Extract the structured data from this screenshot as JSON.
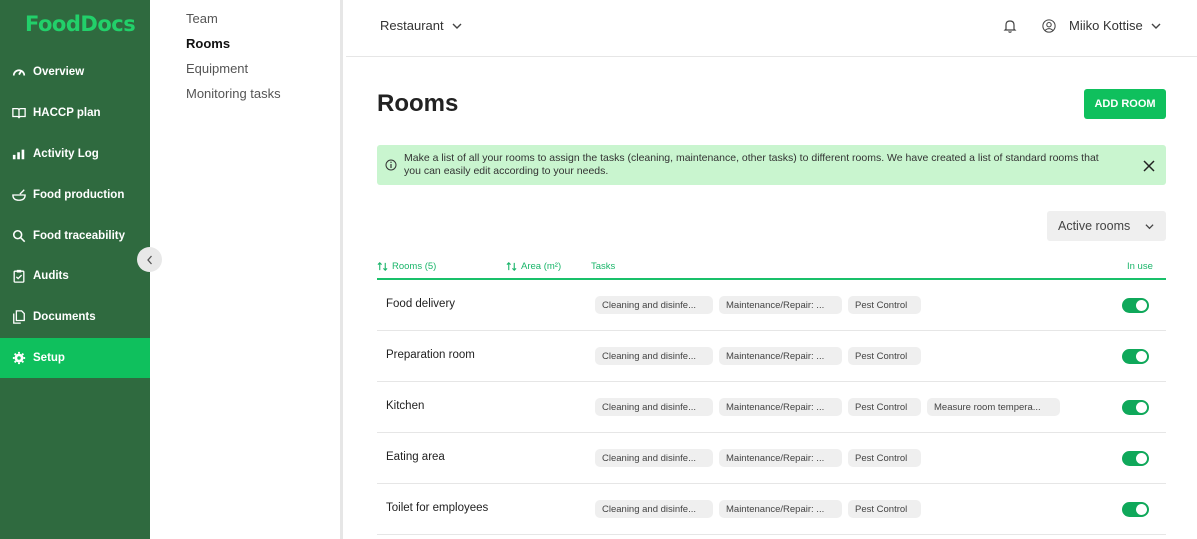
{
  "brand": {
    "logo_text": "FoodDocs",
    "logo_color": "#22d06a",
    "sidebar_bg": "#2f6a3f",
    "accent": "#0fc05d"
  },
  "sidebar": {
    "items": [
      {
        "label": "Overview",
        "icon": "gauge-icon"
      },
      {
        "label": "HACCP plan",
        "icon": "book-icon"
      },
      {
        "label": "Activity Log",
        "icon": "bar-chart-icon"
      },
      {
        "label": "Food production",
        "icon": "bowl-icon"
      },
      {
        "label": "Food traceability",
        "icon": "search-icon"
      },
      {
        "label": "Audits",
        "icon": "clipboard-icon"
      },
      {
        "label": "Documents",
        "icon": "documents-icon"
      },
      {
        "label": "Setup",
        "icon": "gear-icon",
        "active": true
      }
    ]
  },
  "subnav": {
    "items": [
      {
        "label": "Team"
      },
      {
        "label": "Rooms",
        "active": true
      },
      {
        "label": "Equipment"
      },
      {
        "label": "Monitoring tasks"
      }
    ]
  },
  "header": {
    "location": "Restaurant",
    "user_name": "Miiko Kottise"
  },
  "main": {
    "title": "Rooms",
    "add_button": "ADD ROOM",
    "info_text": "Make a list of all your rooms to assign the tasks (cleaning, maintenance, other tasks) to different rooms. We have created a list of standard rooms that you can easily edit according to your needs.",
    "filter_label": "Active rooms",
    "table": {
      "columns": {
        "rooms": "Rooms (5)",
        "area": "Area (m²)",
        "tasks": "Tasks",
        "in_use": "In use"
      },
      "rows": [
        {
          "name": "Food delivery",
          "tasks": [
            "Cleaning and disinfe...",
            "Maintenance/Repair: ...",
            "Pest Control"
          ],
          "in_use": true
        },
        {
          "name": "Preparation room",
          "tasks": [
            "Cleaning and disinfe...",
            "Maintenance/Repair: ...",
            "Pest Control"
          ],
          "in_use": true
        },
        {
          "name": "Kitchen",
          "tasks": [
            "Cleaning and disinfe...",
            "Maintenance/Repair: ...",
            "Pest Control",
            "Measure room tempera..."
          ],
          "in_use": true
        },
        {
          "name": "Eating area",
          "tasks": [
            "Cleaning and disinfe...",
            "Maintenance/Repair: ...",
            "Pest Control"
          ],
          "in_use": true
        },
        {
          "name": "Toilet for employees",
          "tasks": [
            "Cleaning and disinfe...",
            "Maintenance/Repair: ...",
            "Pest Control"
          ],
          "in_use": true
        }
      ]
    }
  }
}
